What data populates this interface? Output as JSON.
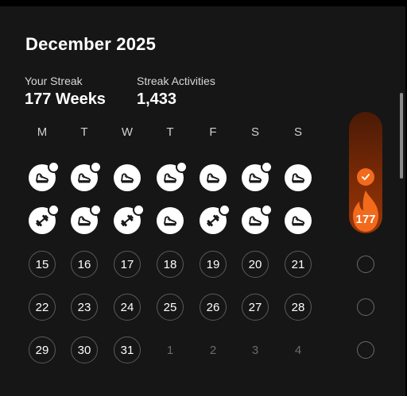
{
  "header": {
    "title": "December 2025"
  },
  "stats": {
    "streak_label": "Your Streak",
    "streak_value": "177 Weeks",
    "activities_label": "Streak Activities",
    "activities_value": "1,433"
  },
  "weekdays": [
    "M",
    "T",
    "W",
    "T",
    "F",
    "S",
    "S"
  ],
  "weeks": [
    [
      {
        "type": "activity",
        "icon": "shoe-icon",
        "extra": true
      },
      {
        "type": "activity",
        "icon": "shoe-icon",
        "extra": true
      },
      {
        "type": "activity",
        "icon": "shoe-icon",
        "extra": false
      },
      {
        "type": "activity",
        "icon": "shoe-icon",
        "extra": true
      },
      {
        "type": "activity",
        "icon": "shoe-icon",
        "extra": false
      },
      {
        "type": "activity",
        "icon": "shoe-icon",
        "extra": true
      },
      {
        "type": "activity",
        "icon": "shoe-icon",
        "extra": false
      }
    ],
    [
      {
        "type": "activity",
        "icon": "dumbbell-icon",
        "extra": true
      },
      {
        "type": "activity",
        "icon": "shoe-icon",
        "extra": true
      },
      {
        "type": "activity",
        "icon": "dumbbell-icon",
        "extra": true
      },
      {
        "type": "activity",
        "icon": "shoe-icon",
        "extra": false
      },
      {
        "type": "activity",
        "icon": "dumbbell-icon",
        "extra": true
      },
      {
        "type": "activity",
        "icon": "shoe-icon",
        "extra": true
      },
      {
        "type": "activity",
        "icon": "shoe-icon",
        "extra": false
      }
    ],
    [
      {
        "type": "day",
        "label": "15"
      },
      {
        "type": "day",
        "label": "16"
      },
      {
        "type": "day",
        "label": "17"
      },
      {
        "type": "day",
        "label": "18"
      },
      {
        "type": "day",
        "label": "19"
      },
      {
        "type": "day",
        "label": "20"
      },
      {
        "type": "day",
        "label": "21"
      }
    ],
    [
      {
        "type": "day",
        "label": "22"
      },
      {
        "type": "day",
        "label": "23"
      },
      {
        "type": "day",
        "label": "24"
      },
      {
        "type": "day",
        "label": "25"
      },
      {
        "type": "day",
        "label": "26"
      },
      {
        "type": "day",
        "label": "27"
      },
      {
        "type": "day",
        "label": "28"
      }
    ],
    [
      {
        "type": "day",
        "label": "29"
      },
      {
        "type": "day",
        "label": "30"
      },
      {
        "type": "day",
        "label": "31"
      },
      {
        "type": "muted",
        "label": "1"
      },
      {
        "type": "muted",
        "label": "2"
      },
      {
        "type": "muted",
        "label": "3"
      },
      {
        "type": "muted",
        "label": "4"
      }
    ]
  ],
  "streak_column": {
    "count": "177",
    "week_status": [
      "complete",
      "complete",
      "open",
      "open",
      "open"
    ]
  },
  "colors": {
    "accent": "#f26a1b",
    "background": "#161616"
  }
}
